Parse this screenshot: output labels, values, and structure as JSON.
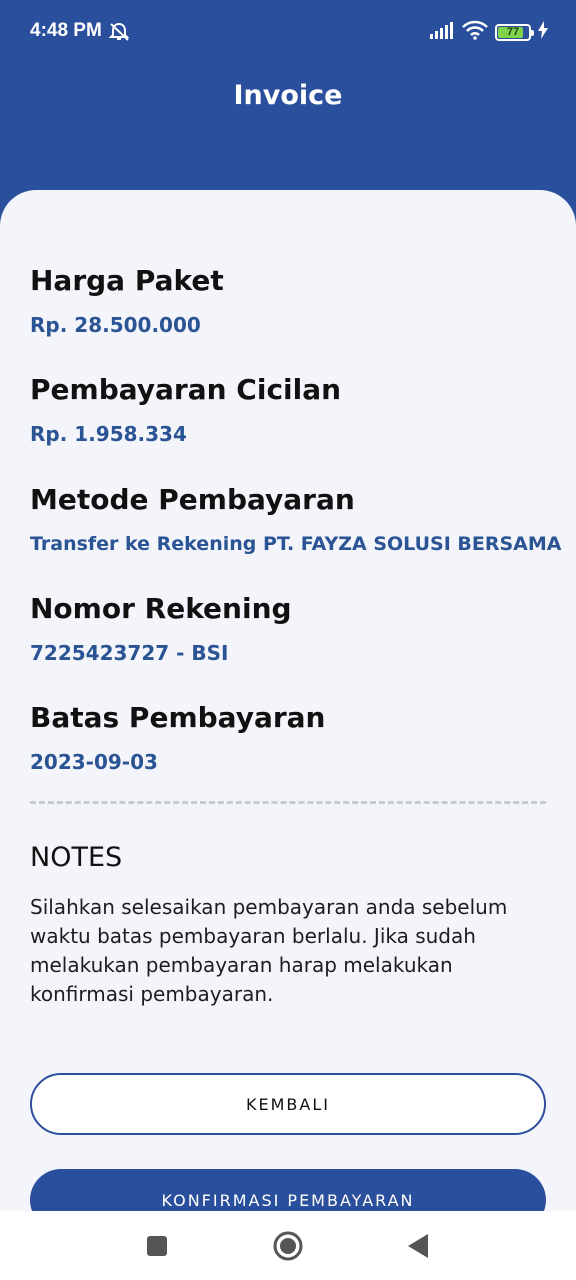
{
  "status_bar": {
    "time": "4:48 PM",
    "battery_level": "77",
    "icons": [
      "mute-icon",
      "signal-icon",
      "wifi-icon",
      "battery-icon",
      "charging-icon"
    ]
  },
  "header": {
    "title": "Invoice"
  },
  "invoice": {
    "fields": [
      {
        "label": "Harga Paket",
        "value": "Rp. 28.500.000"
      },
      {
        "label": "Pembayaran Cicilan",
        "value": "Rp. 1.958.334"
      },
      {
        "label": "Metode Pembayaran",
        "value": "Transfer ke Rekening PT. FAYZA SOLUSI BERSAMA"
      },
      {
        "label": "Nomor Rekening",
        "value": "7225423727 - BSI"
      },
      {
        "label": "Batas Pembayaran",
        "value": "2023-09-03"
      }
    ]
  },
  "notes": {
    "title": "NOTES",
    "text": "Silahkan selesaikan pembayaran anda sebelum waktu batas pembayaran berlalu. Jika sudah melakukan pembayaran harap melakukan konfirmasi pembayaran."
  },
  "actions": {
    "back_label": "KEMBALI",
    "confirm_label": "KONFIRMASI PEMBAYARAN"
  },
  "colors": {
    "primary": "#2a4f9c",
    "value_text": "#2a5494",
    "background": "#f3f5fa"
  },
  "nav_bar": {
    "icons": [
      "recents-icon",
      "home-icon",
      "back-icon"
    ]
  }
}
